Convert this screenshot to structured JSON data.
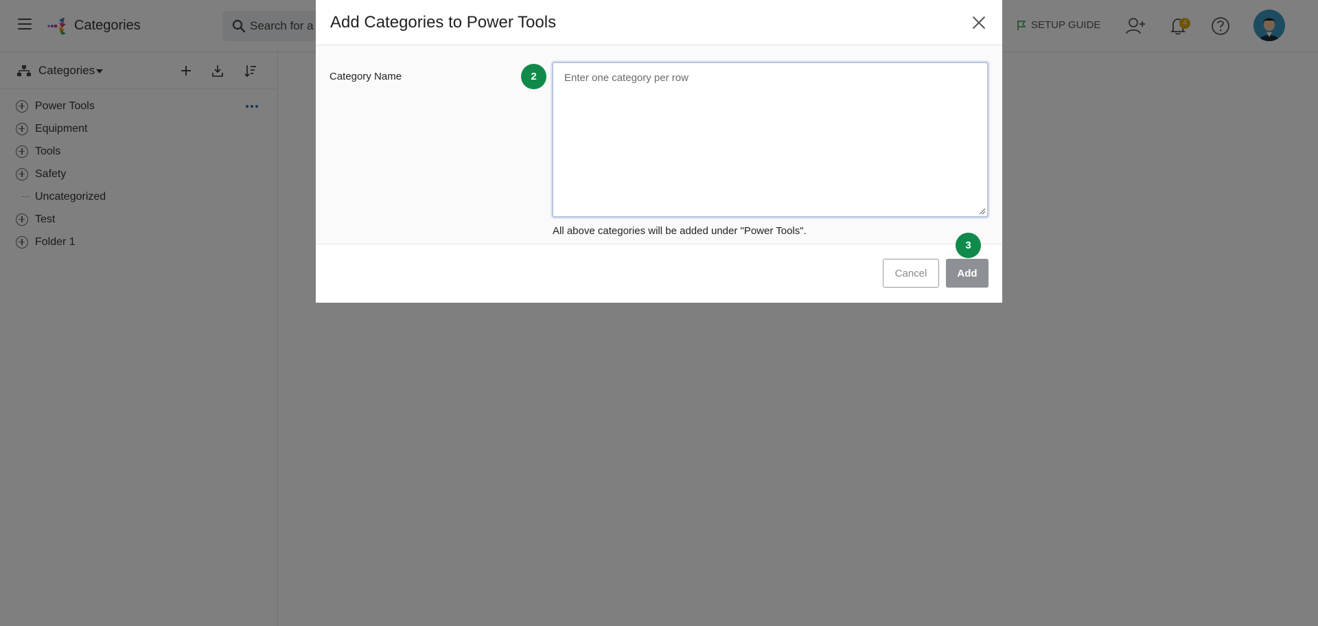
{
  "header": {
    "app_title": "Categories",
    "search_placeholder": "Search for a",
    "setup_guide_label": "SETUP GUIDE",
    "notification_count": "4"
  },
  "sidebar": {
    "title": "Categories",
    "tools": [
      "add-icon",
      "import-icon",
      "sort-icon"
    ],
    "items": [
      {
        "label": "Power Tools",
        "expandable": true
      },
      {
        "label": "Equipment",
        "expandable": true
      },
      {
        "label": "Tools",
        "expandable": true
      },
      {
        "label": "Safety",
        "expandable": true
      },
      {
        "label": "Uncategorized",
        "expandable": false
      },
      {
        "label": "Test",
        "expandable": true
      },
      {
        "label": "Folder 1",
        "expandable": true
      }
    ]
  },
  "modal": {
    "title": "Add Categories to Power Tools",
    "field_label": "Category Name",
    "textarea_value": "",
    "textarea_placeholder": "Enter one category per row",
    "help_text": "All above categories will be added under \"Power Tools\".",
    "cancel_label": "Cancel",
    "add_label": "Add",
    "step_badges": [
      "2",
      "3"
    ]
  },
  "colors": {
    "step_badge": "#0f8a4b",
    "add_button_disabled": "#8d9095",
    "overlay": "rgba(0,0,0,0.5)",
    "notification_badge": "#e0a800",
    "link_blue": "#2b6cb0"
  }
}
